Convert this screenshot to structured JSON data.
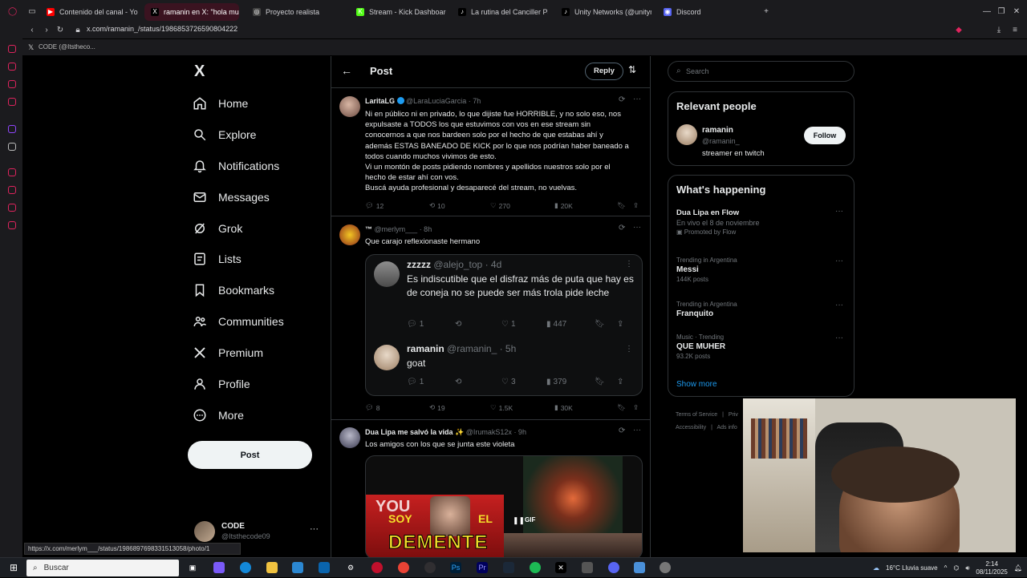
{
  "browser": {
    "tabs": [
      {
        "label": "Contenido del canal - You",
        "color": "#ff0000",
        "glyph": "▶"
      },
      {
        "label": "ramanin en X: \"hola mucl",
        "color": "#000000",
        "glyph": "X",
        "active": true
      },
      {
        "label": "Proyecto realista",
        "color": "#444",
        "glyph": "◎"
      },
      {
        "label": "Stream - Kick Dashboard",
        "color": "#53fc18",
        "glyph": "K"
      },
      {
        "label": "La rutina del Canciller Pa",
        "color": "#000",
        "glyph": "♪"
      },
      {
        "label": "Unity Networks (@unityn",
        "color": "#000",
        "glyph": "♪"
      },
      {
        "label": "Discord",
        "color": "#5865f2",
        "glyph": "◉"
      }
    ],
    "new_tab": "+",
    "url": "x.com/ramanin_/status/1986853726590804222",
    "bookmark": "CODE (@Itsthecо...",
    "status_url": "https://x.com/merlym___/status/1986897698331513058/photo/1"
  },
  "nav": {
    "logo": "X",
    "items": [
      {
        "label": "Home",
        "icon": "home-icon"
      },
      {
        "label": "Explore",
        "icon": "search-icon"
      },
      {
        "label": "Notifications",
        "icon": "bell-icon"
      },
      {
        "label": "Messages",
        "icon": "mail-icon"
      },
      {
        "label": "Grok",
        "icon": "grok-icon"
      },
      {
        "label": "Lists",
        "icon": "list-icon"
      },
      {
        "label": "Bookmarks",
        "icon": "bookmark-icon"
      },
      {
        "label": "Communities",
        "icon": "people-icon"
      },
      {
        "label": "Premium",
        "icon": "x-icon"
      },
      {
        "label": "Profile",
        "icon": "person-icon"
      },
      {
        "label": "More",
        "icon": "more-circle-icon"
      }
    ],
    "post_button": "Post",
    "account": {
      "name": "CODE",
      "handle": "@Itsthecode09"
    }
  },
  "main": {
    "header": {
      "title": "Post",
      "reply": "Reply"
    },
    "tweets": [
      {
        "name": "LaritaLG",
        "handle": "@LaraLuciaGarcia",
        "time": "· 7h",
        "lines": [
          "Ni en público ni en privado, lo que dijiste fue HORRIBLE, y no solo eso, nos",
          "expulsaste a TODOS los que estuvimos con vos en ese stream sin",
          "conocernos a que nos bardeen solo por el hecho de que estabas ahí y",
          "además ESTAS BANEADO DE KICK por lo que nos podrían haber baneado a",
          "todos cuando muchos vivimos de esto.",
          "Vi un montón de posts pidiendo nombres y apellidos nuestros solo por el",
          "hecho de estar ahí con vos.",
          "Buscá ayuda profesional y desaparecé del stream, no vuelvas."
        ],
        "replies": "12",
        "reposts": "10",
        "likes": "270",
        "views": "20K"
      },
      {
        "name": "™",
        "handle": "@merlym___",
        "time": "· 8h",
        "text": "Que carajo reflexionaste hermano",
        "replies": "8",
        "reposts": "19",
        "likes": "1.5K",
        "views": "30K",
        "quote": {
          "name": "zzzzz",
          "handle": "@alejo_top",
          "time": "· 4d",
          "text": "Es indiscutible que el disfraz más de puta que hay es de coneja no se puede ser más trola pide leche",
          "replies": "1",
          "likes": "1",
          "views": "447",
          "reply": {
            "name": "ramanin",
            "handle": "@ramanin_",
            "time": "· 5h",
            "text": "goat",
            "replies": "1",
            "likes": "3",
            "views": "379"
          }
        }
      },
      {
        "name": "Dua Lipa me salvó la vida ✨",
        "handle": "@IrumakS12x",
        "time": "· 9h",
        "text": "Los amigos con los que se junta este violeta",
        "media": {
          "overlay_top": "SOY",
          "overlay_left": "YOU",
          "overlay_el": "EL",
          "overlay_main": "DEMENTE",
          "gif": "GIF"
        }
      }
    ]
  },
  "right": {
    "search_placeholder": "Search",
    "relevant": {
      "title": "Relevant people",
      "name": "ramanin",
      "handle": "@ramanin_",
      "bio": "streamer en twitch",
      "follow": "Follow"
    },
    "happening": {
      "title": "What's happening",
      "trends": [
        {
          "meta": "",
          "name": "Dua Lipa en Flow",
          "count": "En vivo el 8 de noviembre",
          "promo": "Promoted by Flow"
        },
        {
          "meta": "Trending in Argentina",
          "name": "Messi",
          "count": "144K posts"
        },
        {
          "meta": "Trending in Argentina",
          "name": "Franquito",
          "count": ""
        },
        {
          "meta": "Music · Trending",
          "name": "QUE MUHER",
          "count": "93.2K posts"
        }
      ],
      "show_more": "Show more"
    },
    "footer": [
      "Terms of Service",
      "|",
      "Priv",
      "Accessibility",
      "|",
      "Ads info"
    ]
  },
  "taskbar": {
    "search": "Buscar",
    "weather": "16°C Lluvia suave",
    "time": "2:14",
    "date": "08/11/2025"
  }
}
